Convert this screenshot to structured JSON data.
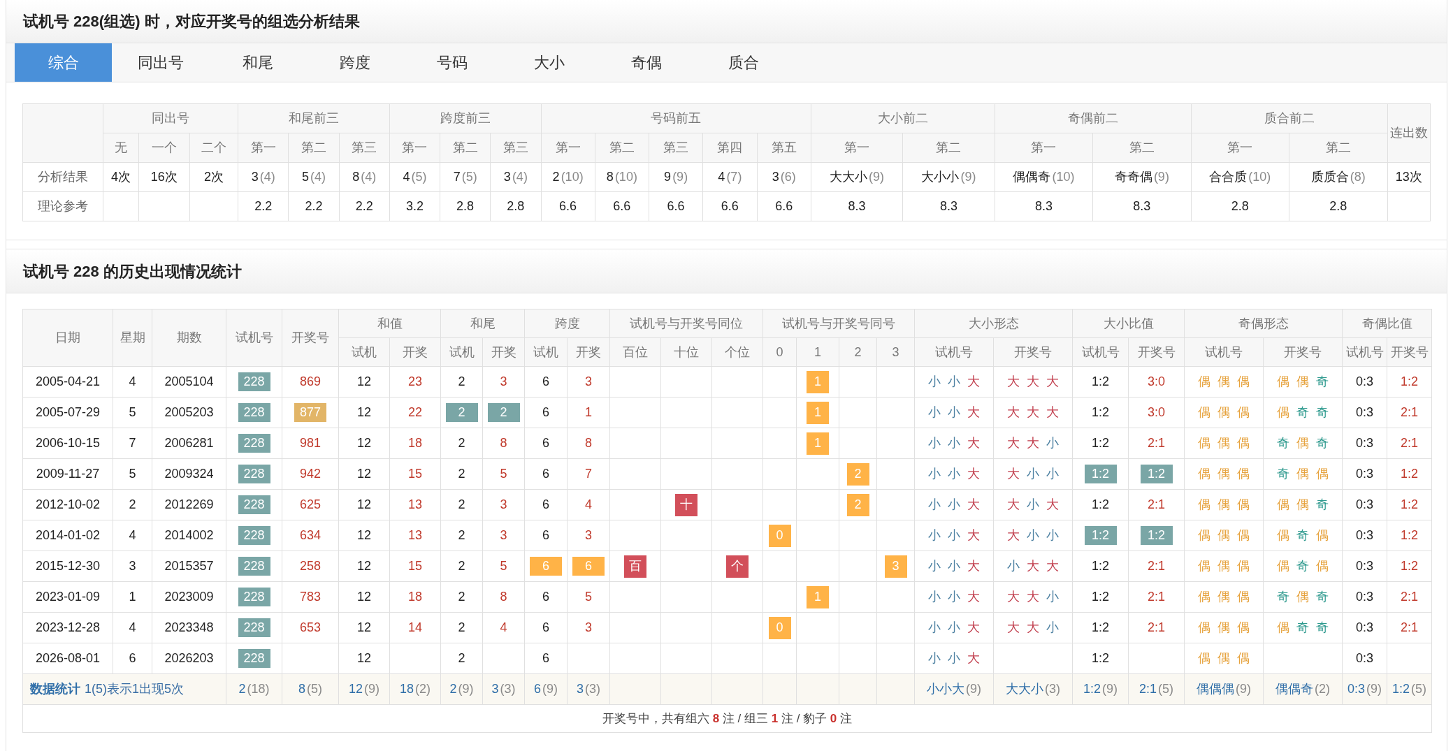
{
  "title": "试机号 228(组选) 时，对应开奖号的组选分析结果",
  "tabs": [
    {
      "label": "综合",
      "selected": true
    },
    {
      "label": "同出号",
      "selected": false
    },
    {
      "label": "和尾",
      "selected": false
    },
    {
      "label": "跨度",
      "selected": false
    },
    {
      "label": "号码",
      "selected": false
    },
    {
      "label": "大小",
      "selected": false
    },
    {
      "label": "奇偶",
      "selected": false
    },
    {
      "label": "质合",
      "selected": false
    }
  ],
  "summary": {
    "groups": [
      {
        "label": "同出号",
        "subs": [
          "无",
          "一个",
          "二个"
        ]
      },
      {
        "label": "和尾前三",
        "subs": [
          "第一",
          "第二",
          "第三"
        ]
      },
      {
        "label": "跨度前三",
        "subs": [
          "第一",
          "第二",
          "第三"
        ]
      },
      {
        "label": "号码前五",
        "subs": [
          "第一",
          "第二",
          "第三",
          "第四",
          "第五"
        ]
      },
      {
        "label": "大小前二",
        "subs": [
          "第一",
          "第二"
        ]
      },
      {
        "label": "奇偶前二",
        "subs": [
          "第一",
          "第二"
        ]
      },
      {
        "label": "质合前二",
        "subs": [
          "第一",
          "第二"
        ]
      },
      {
        "label": "连出数"
      }
    ],
    "rows": [
      {
        "label": "分析结果",
        "cells": [
          "4次",
          "16次",
          "2次",
          {
            "value": "3",
            "count": "(4)"
          },
          {
            "value": "5",
            "count": "(4)"
          },
          {
            "value": "8",
            "count": "(4)"
          },
          {
            "value": "4",
            "count": "(5)"
          },
          {
            "value": "7",
            "count": "(5)"
          },
          {
            "value": "3",
            "count": "(4)"
          },
          {
            "value": "2",
            "count": "(10)"
          },
          {
            "value": "8",
            "count": "(10)"
          },
          {
            "value": "9",
            "count": "(9)"
          },
          {
            "value": "4",
            "count": "(7)"
          },
          {
            "value": "3",
            "count": "(6)"
          },
          {
            "value": "大大小",
            "count": "(9)"
          },
          {
            "value": "大小小",
            "count": "(9)"
          },
          {
            "value": "偶偶奇",
            "count": "(10)"
          },
          {
            "value": "奇奇偶",
            "count": "(9)"
          },
          {
            "value": "合合质",
            "count": "(10)"
          },
          {
            "value": "质质合",
            "count": "(8)"
          },
          "13次"
        ]
      },
      {
        "label": "理论参考",
        "cells": [
          null,
          null,
          null,
          "2.2",
          "2.2",
          "2.2",
          "3.2",
          "2.8",
          "2.8",
          "6.6",
          "6.6",
          "6.6",
          "6.6",
          "6.6",
          "8.3",
          "8.3",
          "8.3",
          "8.3",
          "2.8",
          "2.8",
          null
        ]
      }
    ]
  },
  "history": {
    "title": "试机号 228 的历史出现情况统计",
    "groups": [
      {
        "label": "日期"
      },
      {
        "label": "星期"
      },
      {
        "label": "期数"
      },
      {
        "label": "试机号"
      },
      {
        "label": "开奖号"
      },
      {
        "label": "和值",
        "subs": [
          "试机",
          "开奖"
        ]
      },
      {
        "label": "和尾",
        "subs": [
          "试机",
          "开奖"
        ]
      },
      {
        "label": "跨度",
        "subs": [
          "试机",
          "开奖"
        ]
      },
      {
        "label": "试机号与开奖号同位",
        "subs": [
          "百位",
          "十位",
          "个位"
        ]
      },
      {
        "label": "试机号与开奖号同号",
        "subs": [
          "0",
          "1",
          "2",
          "3"
        ]
      },
      {
        "label": "大小形态",
        "subs": [
          "试机号",
          "开奖号"
        ]
      },
      {
        "label": "大小比值",
        "subs": [
          "试机号",
          "开奖号"
        ]
      },
      {
        "label": "奇偶形态",
        "subs": [
          "试机号",
          "开奖号"
        ]
      },
      {
        "label": "奇偶比值",
        "subs": [
          "试机号",
          "开奖号"
        ]
      }
    ],
    "rows": [
      {
        "date": "2005-04-21",
        "weekday": "4",
        "issue": "2005104",
        "trial": {
          "text": "228",
          "kind": "trial"
        },
        "draw": "869",
        "sum_trial": "12",
        "sum_draw": "23",
        "tail_trial": "2",
        "tail_draw": "3",
        "span_trial": "6",
        "span_draw": "3",
        "same_position": [
          {
            "hit": false
          },
          {
            "hit": false
          },
          {
            "hit": false
          }
        ],
        "same_number": [
          {
            "hit": false
          },
          {
            "hit": true,
            "text": "1"
          },
          {
            "hit": false
          },
          {
            "hit": false
          }
        ],
        "size_trial": [
          {
            "char": "小",
            "kind": "small"
          },
          {
            "char": "小",
            "kind": "small"
          },
          {
            "char": "大",
            "kind": "big"
          }
        ],
        "size_draw": [
          {
            "char": "大",
            "kind": "big"
          },
          {
            "char": "大",
            "kind": "big"
          },
          {
            "char": "大",
            "kind": "big"
          }
        ],
        "size_ratio_trial": "1:2",
        "size_ratio_draw": "3:0",
        "oe_trial": [
          {
            "char": "偶",
            "kind": "even"
          },
          {
            "char": "偶",
            "kind": "even"
          },
          {
            "char": "偶",
            "kind": "even"
          }
        ],
        "oe_draw": [
          {
            "char": "偶",
            "kind": "even"
          },
          {
            "char": "偶",
            "kind": "even"
          },
          {
            "char": "奇",
            "kind": "odd"
          }
        ],
        "oe_ratio_trial": "0:3",
        "oe_ratio_draw": "1:2"
      },
      {
        "date": "2005-07-29",
        "weekday": "5",
        "issue": "2005203",
        "trial": {
          "text": "228",
          "kind": "trial"
        },
        "draw": {
          "text": "877",
          "kind": "pair"
        },
        "sum_trial": "12",
        "sum_draw": "22",
        "tail_trial": {
          "text": "2",
          "kind": "trial"
        },
        "tail_draw": {
          "text": "2",
          "kind": "trial"
        },
        "span_trial": "6",
        "span_draw": "1",
        "same_position": [
          {
            "hit": false
          },
          {
            "hit": false
          },
          {
            "hit": false
          }
        ],
        "same_number": [
          {
            "hit": false
          },
          {
            "hit": true,
            "text": "1"
          },
          {
            "hit": false
          },
          {
            "hit": false
          }
        ],
        "size_trial": [
          {
            "char": "小",
            "kind": "small"
          },
          {
            "char": "小",
            "kind": "small"
          },
          {
            "char": "大",
            "kind": "big"
          }
        ],
        "size_draw": [
          {
            "char": "大",
            "kind": "big"
          },
          {
            "char": "大",
            "kind": "big"
          },
          {
            "char": "大",
            "kind": "big"
          }
        ],
        "size_ratio_trial": "1:2",
        "size_ratio_draw": "3:0",
        "oe_trial": [
          {
            "char": "偶",
            "kind": "even"
          },
          {
            "char": "偶",
            "kind": "even"
          },
          {
            "char": "偶",
            "kind": "even"
          }
        ],
        "oe_draw": [
          {
            "char": "偶",
            "kind": "even"
          },
          {
            "char": "奇",
            "kind": "odd"
          },
          {
            "char": "奇",
            "kind": "odd"
          }
        ],
        "oe_ratio_trial": "0:3",
        "oe_ratio_draw": "2:1"
      },
      {
        "date": "2006-10-15",
        "weekday": "7",
        "issue": "2006281",
        "trial": {
          "text": "228",
          "kind": "trial"
        },
        "draw": "981",
        "sum_trial": "12",
        "sum_draw": "18",
        "tail_trial": "2",
        "tail_draw": "8",
        "span_trial": "6",
        "span_draw": "8",
        "same_position": [
          {
            "hit": false
          },
          {
            "hit": false
          },
          {
            "hit": false
          }
        ],
        "same_number": [
          {
            "hit": false
          },
          {
            "hit": true,
            "text": "1"
          },
          {
            "hit": false
          },
          {
            "hit": false
          }
        ],
        "size_trial": [
          {
            "char": "小",
            "kind": "small"
          },
          {
            "char": "小",
            "kind": "small"
          },
          {
            "char": "大",
            "kind": "big"
          }
        ],
        "size_draw": [
          {
            "char": "大",
            "kind": "big"
          },
          {
            "char": "大",
            "kind": "big"
          },
          {
            "char": "小",
            "kind": "small"
          }
        ],
        "size_ratio_trial": "1:2",
        "size_ratio_draw": "2:1",
        "oe_trial": [
          {
            "char": "偶",
            "kind": "even"
          },
          {
            "char": "偶",
            "kind": "even"
          },
          {
            "char": "偶",
            "kind": "even"
          }
        ],
        "oe_draw": [
          {
            "char": "奇",
            "kind": "odd"
          },
          {
            "char": "偶",
            "kind": "even"
          },
          {
            "char": "奇",
            "kind": "odd"
          }
        ],
        "oe_ratio_trial": "0:3",
        "oe_ratio_draw": "2:1"
      },
      {
        "date": "2009-11-27",
        "weekday": "5",
        "issue": "2009324",
        "trial": {
          "text": "228",
          "kind": "trial"
        },
        "draw": "942",
        "sum_trial": "12",
        "sum_draw": "15",
        "tail_trial": "2",
        "tail_draw": "5",
        "span_trial": "6",
        "span_draw": "7",
        "same_position": [
          {
            "hit": false
          },
          {
            "hit": false
          },
          {
            "hit": false
          }
        ],
        "same_number": [
          {
            "hit": false
          },
          {
            "hit": false
          },
          {
            "hit": true,
            "text": "2"
          },
          {
            "hit": false
          }
        ],
        "size_trial": [
          {
            "char": "小",
            "kind": "small"
          },
          {
            "char": "小",
            "kind": "small"
          },
          {
            "char": "大",
            "kind": "big"
          }
        ],
        "size_draw": [
          {
            "char": "大",
            "kind": "big"
          },
          {
            "char": "小",
            "kind": "small"
          },
          {
            "char": "小",
            "kind": "small"
          }
        ],
        "size_ratio_trial": {
          "text": "1:2",
          "kind": "trial"
        },
        "size_ratio_draw": {
          "text": "1:2",
          "kind": "trial"
        },
        "oe_trial": [
          {
            "char": "偶",
            "kind": "even"
          },
          {
            "char": "偶",
            "kind": "even"
          },
          {
            "char": "偶",
            "kind": "even"
          }
        ],
        "oe_draw": [
          {
            "char": "奇",
            "kind": "odd"
          },
          {
            "char": "偶",
            "kind": "even"
          },
          {
            "char": "偶",
            "kind": "even"
          }
        ],
        "oe_ratio_trial": "0:3",
        "oe_ratio_draw": "1:2"
      },
      {
        "date": "2012-10-02",
        "weekday": "2",
        "issue": "2012269",
        "trial": {
          "text": "228",
          "kind": "trial"
        },
        "draw": "625",
        "sum_trial": "12",
        "sum_draw": "13",
        "tail_trial": "2",
        "tail_draw": "3",
        "span_trial": "6",
        "span_draw": "4",
        "same_position": [
          {
            "hit": false
          },
          {
            "hit": true,
            "text": "十"
          },
          {
            "hit": false
          }
        ],
        "same_number": [
          {
            "hit": false
          },
          {
            "hit": false
          },
          {
            "hit": true,
            "text": "2"
          },
          {
            "hit": false
          }
        ],
        "size_trial": [
          {
            "char": "小",
            "kind": "small"
          },
          {
            "char": "小",
            "kind": "small"
          },
          {
            "char": "大",
            "kind": "big"
          }
        ],
        "size_draw": [
          {
            "char": "大",
            "kind": "big"
          },
          {
            "char": "小",
            "kind": "small"
          },
          {
            "char": "大",
            "kind": "big"
          }
        ],
        "size_ratio_trial": "1:2",
        "size_ratio_draw": "2:1",
        "oe_trial": [
          {
            "char": "偶",
            "kind": "even"
          },
          {
            "char": "偶",
            "kind": "even"
          },
          {
            "char": "偶",
            "kind": "even"
          }
        ],
        "oe_draw": [
          {
            "char": "偶",
            "kind": "even"
          },
          {
            "char": "偶",
            "kind": "even"
          },
          {
            "char": "奇",
            "kind": "odd"
          }
        ],
        "oe_ratio_trial": "0:3",
        "oe_ratio_draw": "1:2"
      },
      {
        "date": "2014-01-02",
        "weekday": "4",
        "issue": "2014002",
        "trial": {
          "text": "228",
          "kind": "trial"
        },
        "draw": "634",
        "sum_trial": "12",
        "sum_draw": "13",
        "tail_trial": "2",
        "tail_draw": "3",
        "span_trial": "6",
        "span_draw": "3",
        "same_position": [
          {
            "hit": false
          },
          {
            "hit": false
          },
          {
            "hit": false
          }
        ],
        "same_number": [
          {
            "hit": true,
            "text": "0"
          },
          {
            "hit": false
          },
          {
            "hit": false
          },
          {
            "hit": false
          }
        ],
        "size_trial": [
          {
            "char": "小",
            "kind": "small"
          },
          {
            "char": "小",
            "kind": "small"
          },
          {
            "char": "大",
            "kind": "big"
          }
        ],
        "size_draw": [
          {
            "char": "大",
            "kind": "big"
          },
          {
            "char": "小",
            "kind": "small"
          },
          {
            "char": "小",
            "kind": "small"
          }
        ],
        "size_ratio_trial": {
          "text": "1:2",
          "kind": "trial"
        },
        "size_ratio_draw": {
          "text": "1:2",
          "kind": "trial"
        },
        "oe_trial": [
          {
            "char": "偶",
            "kind": "even"
          },
          {
            "char": "偶",
            "kind": "even"
          },
          {
            "char": "偶",
            "kind": "even"
          }
        ],
        "oe_draw": [
          {
            "char": "偶",
            "kind": "even"
          },
          {
            "char": "奇",
            "kind": "odd"
          },
          {
            "char": "偶",
            "kind": "even"
          }
        ],
        "oe_ratio_trial": "0:3",
        "oe_ratio_draw": "1:2"
      },
      {
        "date": "2015-12-30",
        "weekday": "3",
        "issue": "2015357",
        "trial": {
          "text": "228",
          "kind": "trial"
        },
        "draw": "258",
        "sum_trial": "12",
        "sum_draw": "15",
        "tail_trial": "2",
        "tail_draw": "5",
        "span_trial": {
          "text": "6",
          "kind": "match"
        },
        "span_draw": {
          "text": "6",
          "kind": "match"
        },
        "same_position": [
          {
            "hit": true,
            "text": "百"
          },
          {
            "hit": false
          },
          {
            "hit": true,
            "text": "个"
          }
        ],
        "same_number": [
          {
            "hit": false
          },
          {
            "hit": false
          },
          {
            "hit": false
          },
          {
            "hit": true,
            "text": "3"
          }
        ],
        "size_trial": [
          {
            "char": "小",
            "kind": "small"
          },
          {
            "char": "小",
            "kind": "small"
          },
          {
            "char": "大",
            "kind": "big"
          }
        ],
        "size_draw": [
          {
            "char": "小",
            "kind": "small"
          },
          {
            "char": "大",
            "kind": "big"
          },
          {
            "char": "大",
            "kind": "big"
          }
        ],
        "size_ratio_trial": "1:2",
        "size_ratio_draw": "2:1",
        "oe_trial": [
          {
            "char": "偶",
            "kind": "even"
          },
          {
            "char": "偶",
            "kind": "even"
          },
          {
            "char": "偶",
            "kind": "even"
          }
        ],
        "oe_draw": [
          {
            "char": "偶",
            "kind": "even"
          },
          {
            "char": "奇",
            "kind": "odd"
          },
          {
            "char": "偶",
            "kind": "even"
          }
        ],
        "oe_ratio_trial": "0:3",
        "oe_ratio_draw": "1:2"
      },
      {
        "date": "2023-01-09",
        "weekday": "1",
        "issue": "2023009",
        "trial": {
          "text": "228",
          "kind": "trial"
        },
        "draw": "783",
        "sum_trial": "12",
        "sum_draw": "18",
        "tail_trial": "2",
        "tail_draw": "8",
        "span_trial": "6",
        "span_draw": "5",
        "same_position": [
          {
            "hit": false
          },
          {
            "hit": false
          },
          {
            "hit": false
          }
        ],
        "same_number": [
          {
            "hit": false
          },
          {
            "hit": true,
            "text": "1"
          },
          {
            "hit": false
          },
          {
            "hit": false
          }
        ],
        "size_trial": [
          {
            "char": "小",
            "kind": "small"
          },
          {
            "char": "小",
            "kind": "small"
          },
          {
            "char": "大",
            "kind": "big"
          }
        ],
        "size_draw": [
          {
            "char": "大",
            "kind": "big"
          },
          {
            "char": "大",
            "kind": "big"
          },
          {
            "char": "小",
            "kind": "small"
          }
        ],
        "size_ratio_trial": "1:2",
        "size_ratio_draw": "2:1",
        "oe_trial": [
          {
            "char": "偶",
            "kind": "even"
          },
          {
            "char": "偶",
            "kind": "even"
          },
          {
            "char": "偶",
            "kind": "even"
          }
        ],
        "oe_draw": [
          {
            "char": "奇",
            "kind": "odd"
          },
          {
            "char": "偶",
            "kind": "even"
          },
          {
            "char": "奇",
            "kind": "odd"
          }
        ],
        "oe_ratio_trial": "0:3",
        "oe_ratio_draw": "2:1"
      },
      {
        "date": "2023-12-28",
        "weekday": "4",
        "issue": "2023348",
        "trial": {
          "text": "228",
          "kind": "trial"
        },
        "draw": "653",
        "sum_trial": "12",
        "sum_draw": "14",
        "tail_trial": "2",
        "tail_draw": "4",
        "span_trial": "6",
        "span_draw": "3",
        "same_position": [
          {
            "hit": false
          },
          {
            "hit": false
          },
          {
            "hit": false
          }
        ],
        "same_number": [
          {
            "hit": true,
            "text": "0"
          },
          {
            "hit": false
          },
          {
            "hit": false
          },
          {
            "hit": false
          }
        ],
        "size_trial": [
          {
            "char": "小",
            "kind": "small"
          },
          {
            "char": "小",
            "kind": "small"
          },
          {
            "char": "大",
            "kind": "big"
          }
        ],
        "size_draw": [
          {
            "char": "大",
            "kind": "big"
          },
          {
            "char": "大",
            "kind": "big"
          },
          {
            "char": "小",
            "kind": "small"
          }
        ],
        "size_ratio_trial": "1:2",
        "size_ratio_draw": "2:1",
        "oe_trial": [
          {
            "char": "偶",
            "kind": "even"
          },
          {
            "char": "偶",
            "kind": "even"
          },
          {
            "char": "偶",
            "kind": "even"
          }
        ],
        "oe_draw": [
          {
            "char": "偶",
            "kind": "even"
          },
          {
            "char": "奇",
            "kind": "odd"
          },
          {
            "char": "奇",
            "kind": "odd"
          }
        ],
        "oe_ratio_trial": "0:3",
        "oe_ratio_draw": "2:1"
      },
      {
        "date": "2026-08-01",
        "weekday": "6",
        "issue": "2026203",
        "trial": {
          "text": "228",
          "kind": "trial"
        },
        "sum_trial": "12",
        "tail_trial": "2",
        "span_trial": "6",
        "same_position": [
          {
            "hit": false
          },
          {
            "hit": false
          },
          {
            "hit": false
          }
        ],
        "same_number": [
          {
            "hit": false
          },
          {
            "hit": false
          },
          {
            "hit": false
          },
          {
            "hit": false
          }
        ],
        "size_trial": [
          {
            "char": "小",
            "kind": "small"
          },
          {
            "char": "小",
            "kind": "small"
          },
          {
            "char": "大",
            "kind": "big"
          }
        ],
        "size_ratio_trial": "1:2",
        "oe_trial": [
          {
            "char": "偶",
            "kind": "even"
          },
          {
            "char": "偶",
            "kind": "even"
          },
          {
            "char": "偶",
            "kind": "even"
          }
        ],
        "oe_ratio_trial": "0:3"
      }
    ],
    "stats": {
      "label": "数据统计",
      "note": "1(5)表示1出现5次",
      "cells": [
        {
          "value": "2",
          "count": "(18)"
        },
        {
          "value": "8",
          "count": "(5)"
        },
        {
          "value": "12",
          "count": "(9)"
        },
        {
          "value": "18",
          "count": "(2)"
        },
        {
          "value": "2",
          "count": "(9)"
        },
        {
          "value": "3",
          "count": "(3)"
        },
        {
          "value": "6",
          "count": "(9)"
        },
        {
          "value": "3",
          "count": "(3)"
        },
        null,
        null,
        null,
        null,
        null,
        null,
        null,
        {
          "value": "小小大",
          "count": "(9)"
        },
        {
          "value": "大大小",
          "count": "(3)"
        },
        {
          "value": "1:2",
          "count": "(9)"
        },
        {
          "value": "2:1",
          "count": "(5)"
        },
        {
          "value": "偶偶偶",
          "count": "(9)"
        },
        {
          "value": "偶偶奇",
          "count": "(2)"
        },
        {
          "value": "0:3",
          "count": "(9)"
        },
        {
          "value": "1:2",
          "count": "(5)"
        }
      ]
    },
    "summary_line": "开奖号中，共有组六 **8** 注 / 组三 **1** 注 / 豹子 **0** 注"
  }
}
